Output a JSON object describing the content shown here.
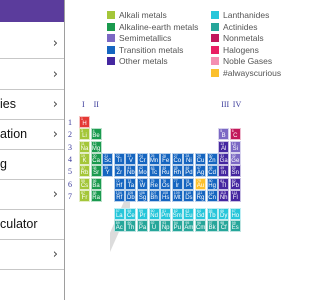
{
  "colors": {
    "header": "#5b3c9c",
    "alkali": "#a4c639",
    "alkaline_earth": "#1a9a4e",
    "semimetal": "#7b68c4",
    "transition": "#1565c0",
    "other_metal": "#4527a0",
    "lanthanide": "#26c6da",
    "actinide": "#26a69a",
    "nonmetal": "#c2185b",
    "halogen": "#e91e63",
    "noble_gas": "#f48fb1",
    "alwayscurious": "#fbc02d",
    "hydrogen": "#e53935"
  },
  "drawer": {
    "items": [
      {
        "label": "",
        "chevron": "›"
      },
      {
        "label": "",
        "chevron": "›"
      },
      {
        "label": "ies",
        "chevron": "›"
      },
      {
        "label": "ation",
        "chevron": "›"
      },
      {
        "label": "g",
        "chevron": ""
      },
      {
        "label": "",
        "chevron": "›"
      },
      {
        "label": "culator",
        "chevron": ""
      },
      {
        "label": "",
        "chevron": "›"
      }
    ]
  },
  "legend": [
    {
      "label": "Alkali metals",
      "color": "#a4c639"
    },
    {
      "label": "Alkaline-earth metals",
      "color": "#1a9a4e"
    },
    {
      "label": "Semimetallics",
      "color": "#7b68c4"
    },
    {
      "label": "Transition metals",
      "color": "#1565c0"
    },
    {
      "label": "Other metals",
      "color": "#4527a0"
    },
    {
      "label": "Lanthanides",
      "color": "#26c6da"
    },
    {
      "label": "Actinides",
      "color": "#26a69a"
    },
    {
      "label": "Nonmetals",
      "color": "#c2185b"
    },
    {
      "label": "Halogens",
      "color": "#e91e63"
    },
    {
      "label": "Noble Gases",
      "color": "#f48fb1"
    },
    {
      "label": "#alwayscurious",
      "color": "#fbc02d"
    }
  ],
  "groups": [
    "I",
    "II",
    "III",
    "IV"
  ],
  "periods": [
    "1",
    "2",
    "3",
    "4",
    "5",
    "6",
    "7"
  ],
  "elements": [
    {
      "n": "1",
      "s": "H",
      "c": "hydrogen",
      "r": 1,
      "g": 1
    },
    {
      "n": "3",
      "s": "Li",
      "c": "alkali",
      "r": 2,
      "g": 1
    },
    {
      "n": "4",
      "s": "Be",
      "c": "alkaline_earth",
      "r": 2,
      "g": 2
    },
    {
      "n": "5",
      "s": "B",
      "c": "semimetal",
      "r": 2,
      "g": 13
    },
    {
      "n": "6",
      "s": "C",
      "c": "nonmetal",
      "r": 2,
      "g": 14
    },
    {
      "n": "11",
      "s": "Na",
      "c": "alkali",
      "r": 3,
      "g": 1
    },
    {
      "n": "12",
      "s": "Mg",
      "c": "alkaline_earth",
      "r": 3,
      "g": 2
    },
    {
      "n": "13",
      "s": "Al",
      "c": "other_metal",
      "r": 3,
      "g": 13
    },
    {
      "n": "14",
      "s": "Si",
      "c": "semimetal",
      "r": 3,
      "g": 14
    },
    {
      "n": "19",
      "s": "K",
      "c": "alkali",
      "r": 4,
      "g": 1
    },
    {
      "n": "20",
      "s": "Ca",
      "c": "alkaline_earth",
      "r": 4,
      "g": 2
    },
    {
      "n": "21",
      "s": "Sc",
      "c": "transition",
      "r": 4,
      "g": 3
    },
    {
      "n": "22",
      "s": "Ti",
      "c": "transition",
      "r": 4,
      "g": 4
    },
    {
      "n": "23",
      "s": "V",
      "c": "transition",
      "r": 4,
      "g": 5
    },
    {
      "n": "24",
      "s": "Cr",
      "c": "transition",
      "r": 4,
      "g": 6
    },
    {
      "n": "25",
      "s": "Mn",
      "c": "transition",
      "r": 4,
      "g": 7
    },
    {
      "n": "26",
      "s": "Fe",
      "c": "transition",
      "r": 4,
      "g": 8
    },
    {
      "n": "27",
      "s": "Co",
      "c": "transition",
      "r": 4,
      "g": 9
    },
    {
      "n": "28",
      "s": "Ni",
      "c": "transition",
      "r": 4,
      "g": 10
    },
    {
      "n": "29",
      "s": "Cu",
      "c": "transition",
      "r": 4,
      "g": 11
    },
    {
      "n": "30",
      "s": "Zn",
      "c": "transition",
      "r": 4,
      "g": 12
    },
    {
      "n": "31",
      "s": "Ga",
      "c": "other_metal",
      "r": 4,
      "g": 13
    },
    {
      "n": "32",
      "s": "Ge",
      "c": "semimetal",
      "r": 4,
      "g": 14
    },
    {
      "n": "37",
      "s": "Rb",
      "c": "alkali",
      "r": 5,
      "g": 1
    },
    {
      "n": "38",
      "s": "Sr",
      "c": "alkaline_earth",
      "r": 5,
      "g": 2
    },
    {
      "n": "39",
      "s": "Y",
      "c": "transition",
      "r": 5,
      "g": 3
    },
    {
      "n": "40",
      "s": "Zr",
      "c": "transition",
      "r": 5,
      "g": 4
    },
    {
      "n": "41",
      "s": "Nb",
      "c": "transition",
      "r": 5,
      "g": 5
    },
    {
      "n": "42",
      "s": "Mo",
      "c": "transition",
      "r": 5,
      "g": 6
    },
    {
      "n": "43",
      "s": "Tc",
      "c": "transition",
      "r": 5,
      "g": 7
    },
    {
      "n": "44",
      "s": "Ru",
      "c": "transition",
      "r": 5,
      "g": 8
    },
    {
      "n": "45",
      "s": "Rh",
      "c": "transition",
      "r": 5,
      "g": 9
    },
    {
      "n": "46",
      "s": "Pd",
      "c": "transition",
      "r": 5,
      "g": 10
    },
    {
      "n": "47",
      "s": "Ag",
      "c": "transition",
      "r": 5,
      "g": 11
    },
    {
      "n": "48",
      "s": "Cd",
      "c": "transition",
      "r": 5,
      "g": 12
    },
    {
      "n": "49",
      "s": "In",
      "c": "other_metal",
      "r": 5,
      "g": 13
    },
    {
      "n": "50",
      "s": "Sn",
      "c": "other_metal",
      "r": 5,
      "g": 14
    },
    {
      "n": "55",
      "s": "Cs",
      "c": "alkali",
      "r": 6,
      "g": 1
    },
    {
      "n": "56",
      "s": "Ba",
      "c": "alkaline_earth",
      "r": 6,
      "g": 2
    },
    {
      "n": "72",
      "s": "Hf",
      "c": "transition",
      "r": 6,
      "g": 4
    },
    {
      "n": "73",
      "s": "Ta",
      "c": "transition",
      "r": 6,
      "g": 5
    },
    {
      "n": "74",
      "s": "W",
      "c": "transition",
      "r": 6,
      "g": 6
    },
    {
      "n": "75",
      "s": "Re",
      "c": "transition",
      "r": 6,
      "g": 7
    },
    {
      "n": "76",
      "s": "Os",
      "c": "transition",
      "r": 6,
      "g": 8
    },
    {
      "n": "77",
      "s": "Ir",
      "c": "transition",
      "r": 6,
      "g": 9
    },
    {
      "n": "78",
      "s": "Pt",
      "c": "transition",
      "r": 6,
      "g": 10
    },
    {
      "n": "79",
      "s": "Au",
      "c": "alwayscurious",
      "r": 6,
      "g": 11
    },
    {
      "n": "80",
      "s": "Hg",
      "c": "transition",
      "r": 6,
      "g": 12
    },
    {
      "n": "81",
      "s": "Tl",
      "c": "other_metal",
      "r": 6,
      "g": 13
    },
    {
      "n": "82",
      "s": "Pb",
      "c": "other_metal",
      "r": 6,
      "g": 14
    },
    {
      "n": "87",
      "s": "Fr",
      "c": "alkali",
      "r": 7,
      "g": 1
    },
    {
      "n": "88",
      "s": "Ra",
      "c": "alkaline_earth",
      "r": 7,
      "g": 2
    },
    {
      "n": "104",
      "s": "Rf",
      "c": "transition",
      "r": 7,
      "g": 4
    },
    {
      "n": "105",
      "s": "Db",
      "c": "transition",
      "r": 7,
      "g": 5
    },
    {
      "n": "106",
      "s": "Sg",
      "c": "transition",
      "r": 7,
      "g": 6
    },
    {
      "n": "107",
      "s": "Bh",
      "c": "transition",
      "r": 7,
      "g": 7
    },
    {
      "n": "108",
      "s": "Hs",
      "c": "transition",
      "r": 7,
      "g": 8
    },
    {
      "n": "109",
      "s": "Mt",
      "c": "transition",
      "r": 7,
      "g": 9
    },
    {
      "n": "110",
      "s": "Ds",
      "c": "transition",
      "r": 7,
      "g": 10
    },
    {
      "n": "111",
      "s": "Rg",
      "c": "transition",
      "r": 7,
      "g": 11
    },
    {
      "n": "112",
      "s": "Cn",
      "c": "transition",
      "r": 7,
      "g": 12
    },
    {
      "n": "113",
      "s": "Nh",
      "c": "other_metal",
      "r": 7,
      "g": 13
    },
    {
      "n": "114",
      "s": "Fl",
      "c": "other_metal",
      "r": 7,
      "g": 14
    },
    {
      "n": "57",
      "s": "La",
      "c": "lanthanide",
      "r": 9,
      "g": 4
    },
    {
      "n": "58",
      "s": "Ce",
      "c": "lanthanide",
      "r": 9,
      "g": 5
    },
    {
      "n": "59",
      "s": "Pr",
      "c": "lanthanide",
      "r": 9,
      "g": 6
    },
    {
      "n": "60",
      "s": "Nd",
      "c": "lanthanide",
      "r": 9,
      "g": 7
    },
    {
      "n": "61",
      "s": "Pm",
      "c": "lanthanide",
      "r": 9,
      "g": 8
    },
    {
      "n": "62",
      "s": "Sm",
      "c": "lanthanide",
      "r": 9,
      "g": 9
    },
    {
      "n": "63",
      "s": "Eu",
      "c": "lanthanide",
      "r": 9,
      "g": 10
    },
    {
      "n": "64",
      "s": "Gd",
      "c": "lanthanide",
      "r": 9,
      "g": 11
    },
    {
      "n": "65",
      "s": "Tb",
      "c": "lanthanide",
      "r": 9,
      "g": 12
    },
    {
      "n": "66",
      "s": "Dy",
      "c": "lanthanide",
      "r": 9,
      "g": 13
    },
    {
      "n": "67",
      "s": "Ho",
      "c": "lanthanide",
      "r": 9,
      "g": 14
    },
    {
      "n": "89",
      "s": "Ac",
      "c": "actinide",
      "r": 10,
      "g": 4
    },
    {
      "n": "90",
      "s": "Th",
      "c": "actinide",
      "r": 10,
      "g": 5
    },
    {
      "n": "91",
      "s": "Pa",
      "c": "actinide",
      "r": 10,
      "g": 6
    },
    {
      "n": "92",
      "s": "U",
      "c": "actinide",
      "r": 10,
      "g": 7
    },
    {
      "n": "93",
      "s": "Np",
      "c": "actinide",
      "r": 10,
      "g": 8
    },
    {
      "n": "94",
      "s": "Pu",
      "c": "actinide",
      "r": 10,
      "g": 9
    },
    {
      "n": "95",
      "s": "Am",
      "c": "actinide",
      "r": 10,
      "g": 10
    },
    {
      "n": "96",
      "s": "Cm",
      "c": "actinide",
      "r": 10,
      "g": 11
    },
    {
      "n": "97",
      "s": "Bk",
      "c": "actinide",
      "r": 10,
      "g": 12
    },
    {
      "n": "98",
      "s": "Cf",
      "c": "actinide",
      "r": 10,
      "g": 13
    },
    {
      "n": "99",
      "s": "Es",
      "c": "actinide",
      "r": 10,
      "g": 14
    }
  ]
}
